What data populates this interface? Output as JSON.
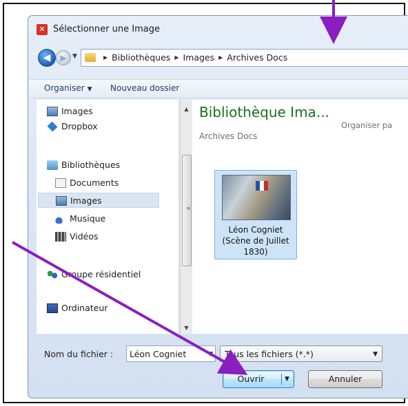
{
  "dialog": {
    "title": "Sélectionner une Image",
    "app_icon": "close-x-icon"
  },
  "address": {
    "crumbs": [
      "Bibliothèques",
      "Images",
      "Archives Docs"
    ]
  },
  "toolbar": {
    "organise_label": "Organiser",
    "new_folder_label": "Nouveau dossier"
  },
  "nav_pane": {
    "items": [
      {
        "label": "Images",
        "icon": "images-icon"
      },
      {
        "label": "Dropbox",
        "icon": "dropbox-icon"
      },
      {
        "label": "Bibliothèques",
        "icon": "libraries-icon"
      },
      {
        "label": "Documents",
        "icon": "documents-icon"
      },
      {
        "label": "Images",
        "icon": "images-icon",
        "selected": true
      },
      {
        "label": "Musique",
        "icon": "music-icon"
      },
      {
        "label": "Vidéos",
        "icon": "videos-icon"
      },
      {
        "label": "Groupe résidentiel",
        "icon": "homegroup-icon"
      },
      {
        "label": "Ordinateur",
        "icon": "computer-icon"
      }
    ]
  },
  "content": {
    "library_title": "Bibliothèque Ima...",
    "library_subtitle": "Archives Docs",
    "arrange_label": "Organiser pa",
    "file": {
      "label": "Léon Cogniet (Scène de Juillet 1830)"
    }
  },
  "footer": {
    "filename_label": "Nom du fichier :",
    "filename_value": "Léon Cogniet",
    "filetype_value": "Tous les fichiers (*.*)",
    "open_label": "Ouvrir",
    "cancel_label": "Annuler"
  },
  "colors": {
    "annotation_arrow": "#8a1ec0",
    "library_title": "#1e6e1e"
  }
}
